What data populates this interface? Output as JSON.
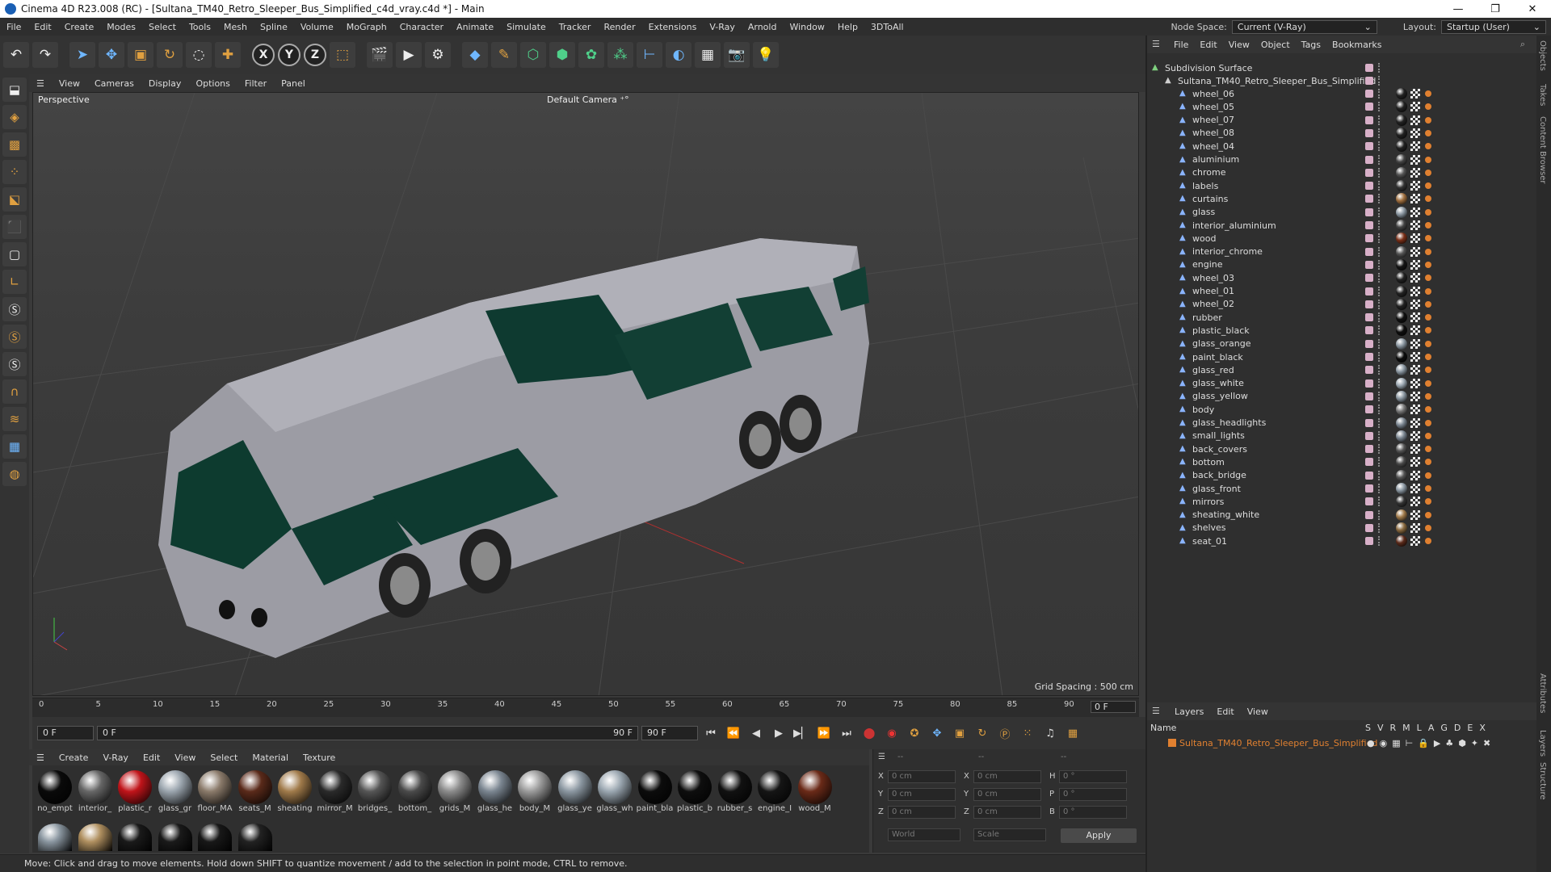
{
  "window": {
    "title": "Cinema 4D R23.008 (RC) - [Sultana_TM40_Retro_Sleeper_Bus_Simplified_c4d_vray.c4d *] - Main",
    "minimize": "—",
    "maximize": "❐",
    "close": "✕"
  },
  "menubar": {
    "items": [
      "File",
      "Edit",
      "Create",
      "Modes",
      "Select",
      "Tools",
      "Mesh",
      "Spline",
      "Volume",
      "MoGraph",
      "Character",
      "Animate",
      "Simulate",
      "Tracker",
      "Render",
      "Extensions",
      "V-Ray",
      "Arnold",
      "Window",
      "Help",
      "3DToAll"
    ],
    "node_space_label": "Node Space:",
    "node_space_value": "Current (V-Ray)",
    "layout_label": "Layout:",
    "layout_value": "Startup (User)"
  },
  "viewport": {
    "menu": [
      "View",
      "Cameras",
      "Display",
      "Options",
      "Filter",
      "Panel"
    ],
    "label": "Perspective",
    "camera": "Default Camera ⁺°",
    "grid_spacing": "Grid Spacing : 500 cm"
  },
  "timeline": {
    "ticks": [
      "0",
      "5",
      "10",
      "15",
      "20",
      "25",
      "30",
      "35",
      "40",
      "45",
      "50",
      "55",
      "60",
      "65",
      "70",
      "75",
      "80",
      "85",
      "90"
    ],
    "current_frame": "0 F"
  },
  "transport": {
    "start": "0 F",
    "range_start": "0 F",
    "range_end": "90 F",
    "end": "90 F"
  },
  "materials": {
    "menu": [
      "Create",
      "V-Ray",
      "Edit",
      "View",
      "Select",
      "Material",
      "Texture"
    ],
    "items": [
      {
        "label": "no_empt",
        "color": "#0a0a0a"
      },
      {
        "label": "interior_",
        "color": "#666"
      },
      {
        "label": "plastic_r",
        "color": "#c0141a"
      },
      {
        "label": "glass_gr",
        "color": "#9aa4ad"
      },
      {
        "label": "floor_MA",
        "color": "#8a7a6a"
      },
      {
        "label": "seats_M",
        "color": "#5a2a1a"
      },
      {
        "label": "sheating",
        "color": "#a07a4a"
      },
      {
        "label": "mirror_M",
        "color": "#2a2a2a"
      },
      {
        "label": "bridges_",
        "color": "#555"
      },
      {
        "label": "bottom_",
        "color": "#4a4a4a"
      },
      {
        "label": "grids_M",
        "color": "#8a8a8a"
      },
      {
        "label": "glass_he",
        "color": "#7a8590"
      },
      {
        "label": "body_M",
        "color": "#9a9a9a"
      },
      {
        "label": "glass_ye",
        "color": "#8a96a0"
      },
      {
        "label": "glass_wh",
        "color": "#9aa6b0"
      },
      {
        "label": "paint_bla",
        "color": "#0c0c0c"
      },
      {
        "label": "plastic_b",
        "color": "#0e0e0e"
      },
      {
        "label": "rubber_s",
        "color": "#111"
      },
      {
        "label": "engine_I",
        "color": "#151515"
      },
      {
        "label": "wood_M",
        "color": "#6a2a18"
      }
    ],
    "row2": [
      "#8a96a0",
      "#b09060",
      "#1a1a1a",
      "#1a1a1a",
      "#181818",
      "#222"
    ]
  },
  "coords": {
    "header": [
      "--",
      "--",
      "--"
    ],
    "rows": [
      [
        "X",
        "0 cm",
        "X",
        "0 cm",
        "H",
        "0 °"
      ],
      [
        "Y",
        "0 cm",
        "Y",
        "0 cm",
        "P",
        "0 °"
      ],
      [
        "Z",
        "0 cm",
        "Z",
        "0 cm",
        "B",
        "0 °"
      ]
    ],
    "mode1": "World",
    "mode2": "Scale",
    "apply": "Apply"
  },
  "status": "Move: Click and drag to move elements. Hold down SHIFT to quantize movement / add to the selection in point mode, CTRL to remove.",
  "objects": {
    "menu": [
      "File",
      "Edit",
      "View",
      "Object",
      "Tags",
      "Bookmarks"
    ],
    "root": "Subdivision Surface",
    "group": "Sultana_TM40_Retro_Sleeper_Bus_Simplified",
    "items": [
      {
        "name": "wheel_06",
        "mat": "#222"
      },
      {
        "name": "wheel_05",
        "mat": "#222"
      },
      {
        "name": "wheel_07",
        "mat": "#222"
      },
      {
        "name": "wheel_08",
        "mat": "#222"
      },
      {
        "name": "wheel_04",
        "mat": "#222"
      },
      {
        "name": "aluminium",
        "mat": "#444"
      },
      {
        "name": "chrome",
        "mat": "#555"
      },
      {
        "name": "labels",
        "mat": "#333"
      },
      {
        "name": "curtains",
        "mat": "#a07040"
      },
      {
        "name": "glass",
        "mat": "#8a96a0"
      },
      {
        "name": "interior_aluminium",
        "mat": "#444"
      },
      {
        "name": "wood",
        "mat": "#7a3018"
      },
      {
        "name": "interior_chrome",
        "mat": "#555"
      },
      {
        "name": "engine",
        "mat": "#151515"
      },
      {
        "name": "wheel_03",
        "mat": "#222"
      },
      {
        "name": "wheel_01",
        "mat": "#222"
      },
      {
        "name": "wheel_02",
        "mat": "#222"
      },
      {
        "name": "rubber",
        "mat": "#111"
      },
      {
        "name": "plastic_black",
        "mat": "#0e0e0e"
      },
      {
        "name": "glass_orange",
        "mat": "#8a96a0"
      },
      {
        "name": "paint_black",
        "mat": "#0c0c0c"
      },
      {
        "name": "glass_red",
        "mat": "#8a96a0"
      },
      {
        "name": "glass_white",
        "mat": "#9aa6b0"
      },
      {
        "name": "glass_yellow",
        "mat": "#8a96a0"
      },
      {
        "name": "body",
        "mat": "#777"
      },
      {
        "name": "glass_headlights",
        "mat": "#7a8590"
      },
      {
        "name": "small_lights",
        "mat": "#7a8590"
      },
      {
        "name": "back_covers",
        "mat": "#555"
      },
      {
        "name": "bottom",
        "mat": "#4a4a4a"
      },
      {
        "name": "back_bridge",
        "mat": "#555"
      },
      {
        "name": "glass_front",
        "mat": "#8a96a0"
      },
      {
        "name": "mirrors",
        "mat": "#333"
      },
      {
        "name": "sheating_white",
        "mat": "#a07a4a"
      },
      {
        "name": "shelves",
        "mat": "#8a6a40"
      },
      {
        "name": "seat_01",
        "mat": "#5a2a1a"
      }
    ]
  },
  "layers": {
    "menu": [
      "Layers",
      "Edit",
      "View"
    ],
    "name_col": "Name",
    "flags": [
      "S",
      "V",
      "R",
      "M",
      "L",
      "A",
      "G",
      "D",
      "E",
      "X"
    ],
    "layer": "Sultana_TM40_Retro_Sleeper_Bus_Simplified",
    "layer_color": "#e08030"
  },
  "side_tabs": [
    "Objects",
    "Takes",
    "Content Browser",
    "Attributes",
    "Layers",
    "Structure"
  ]
}
